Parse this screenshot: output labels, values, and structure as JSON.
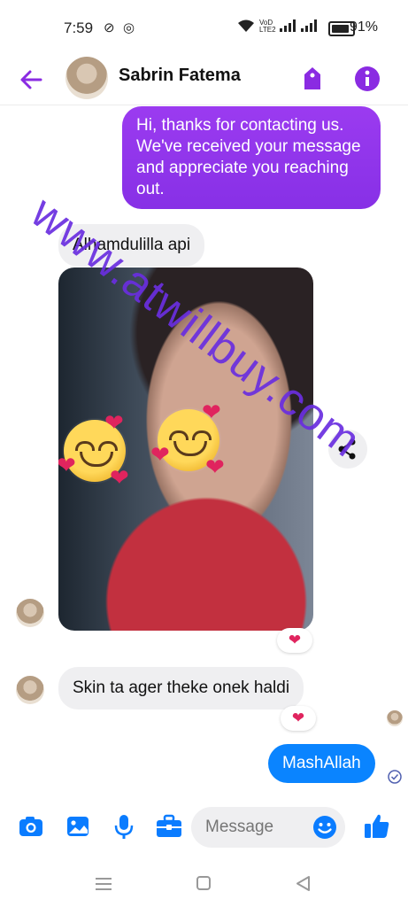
{
  "status_bar": {
    "time": "7:59",
    "battery": "91%",
    "network_label": "VoD LTE2"
  },
  "header": {
    "contact_name": "Sabrin Fatema"
  },
  "messages": {
    "outgoing_auto": "Hi, thanks for contacting us. We've received your message and appreciate you reaching out.",
    "incoming_1": "Alhamdulilla api",
    "incoming_2": "Skin ta ager theke onek haldi",
    "outgoing_2": "MashAllah",
    "reaction_1": "❤",
    "reaction_2": "❤"
  },
  "watermark": "www.atwillbuy.com",
  "composer": {
    "placeholder": "Message"
  },
  "colors": {
    "accent_purple": "#8a2be2",
    "bubble_blue": "#0a84ff",
    "icon_blue": "#0a7cff"
  },
  "icons": {
    "header": [
      "back-arrow-icon",
      "tag-icon",
      "info-icon"
    ],
    "composer": [
      "camera-icon",
      "gallery-icon",
      "microphone-icon",
      "briefcase-icon",
      "emoji-icon",
      "thumbs-up-icon"
    ],
    "nav": [
      "recent-apps-icon",
      "home-icon",
      "back-icon"
    ]
  }
}
